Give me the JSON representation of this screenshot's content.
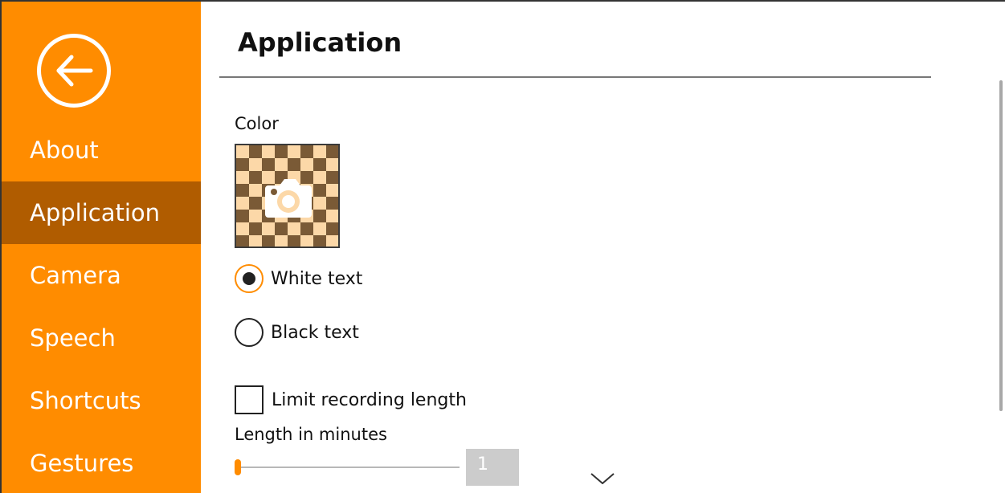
{
  "colors": {
    "accent": "#ff8c00",
    "sidebar_active": "#b05c00",
    "swatch_light": "#fcd8a8",
    "swatch_dark": "#7a5a36"
  },
  "sidebar": {
    "back_icon": "back-arrow-icon",
    "items": [
      {
        "label": "About",
        "active": false
      },
      {
        "label": "Application",
        "active": true
      },
      {
        "label": "Camera",
        "active": false
      },
      {
        "label": "Speech",
        "active": false
      },
      {
        "label": "Shortcuts",
        "active": false
      },
      {
        "label": "Gestures",
        "active": false
      }
    ]
  },
  "header": {
    "title": "Application"
  },
  "settings": {
    "color_label": "Color",
    "swatch_icon": "camera-icon",
    "text_options": [
      {
        "label": "White text",
        "selected": true
      },
      {
        "label": "Black text",
        "selected": false
      }
    ],
    "limit_recording": {
      "label": "Limit recording length",
      "checked": false
    },
    "length": {
      "label": "Length in minutes",
      "value": "1",
      "slider_fraction": 0
    },
    "more_icon": "chevron-down-icon"
  }
}
